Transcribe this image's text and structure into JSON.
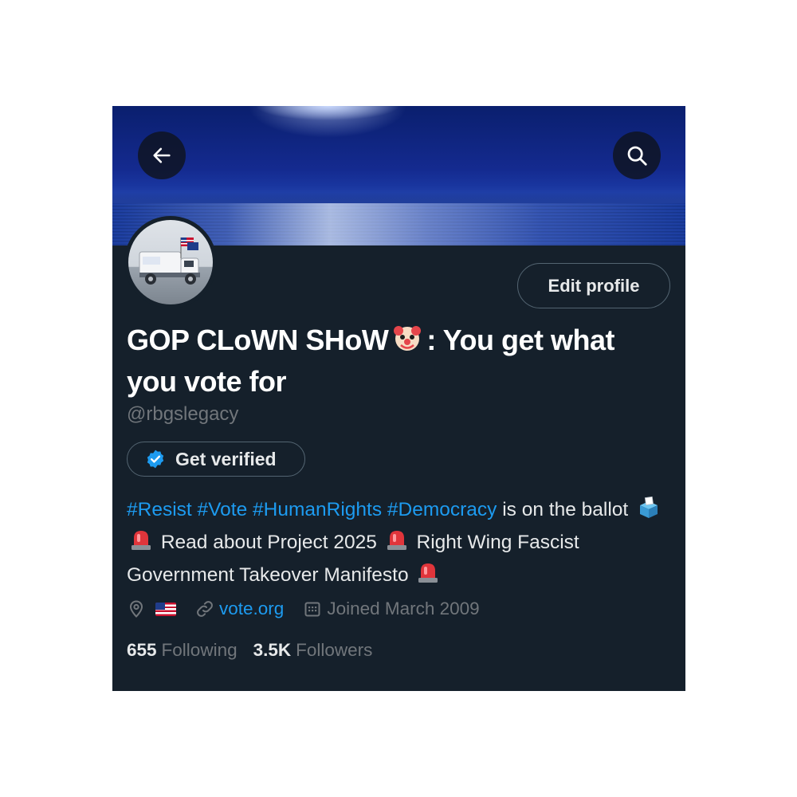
{
  "profile": {
    "display_name": "GOP CLoWN SHoW 🤡: You get what you vote for",
    "display_name_part1": "GOP CLoWN SHoW",
    "display_name_part2": ": You get what you vote for",
    "handle": "@rbgslegacy",
    "edit_profile_label": "Edit profile",
    "get_verified_label": "Get verified"
  },
  "bio": {
    "hashtags": [
      "#Resist",
      "#Vote",
      "#HumanRights",
      "#Democracy"
    ],
    "text1": " is on the ballot",
    "text2": "Read about Project 2025",
    "text3": "Right Wing Fascist Government Takeover Manifesto"
  },
  "meta": {
    "location_flag": "🇺🇸",
    "website": "vote.org",
    "joined": "Joined March 2009"
  },
  "stats": {
    "following_count": "655",
    "following_label": "Following",
    "followers_count": "3.5K",
    "followers_label": "Followers"
  },
  "icons": [
    "back-arrow-icon",
    "search-icon",
    "verified-badge-icon",
    "location-icon",
    "link-icon",
    "calendar-icon",
    "clown-emoji-icon",
    "ballot-box-emoji-icon",
    "siren-emoji-icon",
    "us-flag-icon"
  ],
  "colors": {
    "background": "#15202b",
    "accent": "#1d9bf0",
    "muted": "#71767b",
    "text": "#e7e9ea"
  }
}
